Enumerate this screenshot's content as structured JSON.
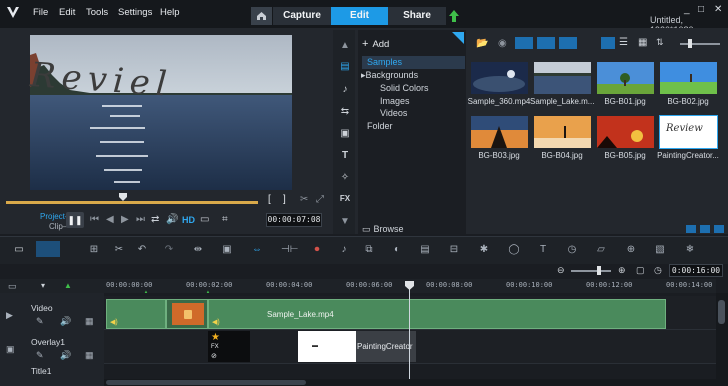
{
  "menu": {
    "file": "File",
    "edit": "Edit",
    "tools": "Tools",
    "settings": "Settings",
    "help": "Help"
  },
  "tabs": {
    "capture": "Capture",
    "edit": "Edit",
    "share": "Share"
  },
  "document": {
    "title": "Untitled, 1920*1080"
  },
  "window_controls": {
    "minimize": "_",
    "maximize": "□",
    "close": "✕"
  },
  "player": {
    "overlay_text": "Reviel",
    "project_label": "Project–",
    "clip_label": "Clip–",
    "hd_label": "HD",
    "timecode": "00:00:07:08",
    "mark_in": "[",
    "mark_out": "]",
    "scrub_position": 0.47
  },
  "library": {
    "add_label": "Add",
    "browse_label": "Browse",
    "tree": {
      "samples": "Samples",
      "backgrounds": "Backgrounds",
      "solid_colors": "Solid Colors",
      "images": "Images",
      "videos": "Videos",
      "folder": "Folder"
    },
    "thumbnails": [
      {
        "name": "Sample_360.mp4"
      },
      {
        "name": "Sample_Lake.m..."
      },
      {
        "name": "BG-B01.jpg"
      },
      {
        "name": "BG-B02.jpg"
      },
      {
        "name": "BG-B03.jpg"
      },
      {
        "name": "BG-B04.jpg"
      },
      {
        "name": "BG-B05.jpg"
      },
      {
        "name": "PaintingCreator..."
      }
    ],
    "painting_thumb_text": "Review"
  },
  "timeline": {
    "timecode": "0:00:16:00",
    "ruler_labels": [
      "00:00:00:00",
      "00:00:02:00",
      "00:00:04:00",
      "00:00:06:00",
      "00:00:08:00",
      "00:00:10:00",
      "00:00:12:00",
      "00:00:14:00"
    ],
    "tracks": {
      "video": "Video",
      "overlay": "Overlay1",
      "title": "Title1"
    },
    "clips": {
      "lake": "Sample_Lake.mp4",
      "painting": "PaintingCreator"
    },
    "fx_label": "FX"
  },
  "colors": {
    "accent": "#1d9ae6",
    "clip_green": "#4a8a5c",
    "scrub_gold": "#d9a94a"
  }
}
